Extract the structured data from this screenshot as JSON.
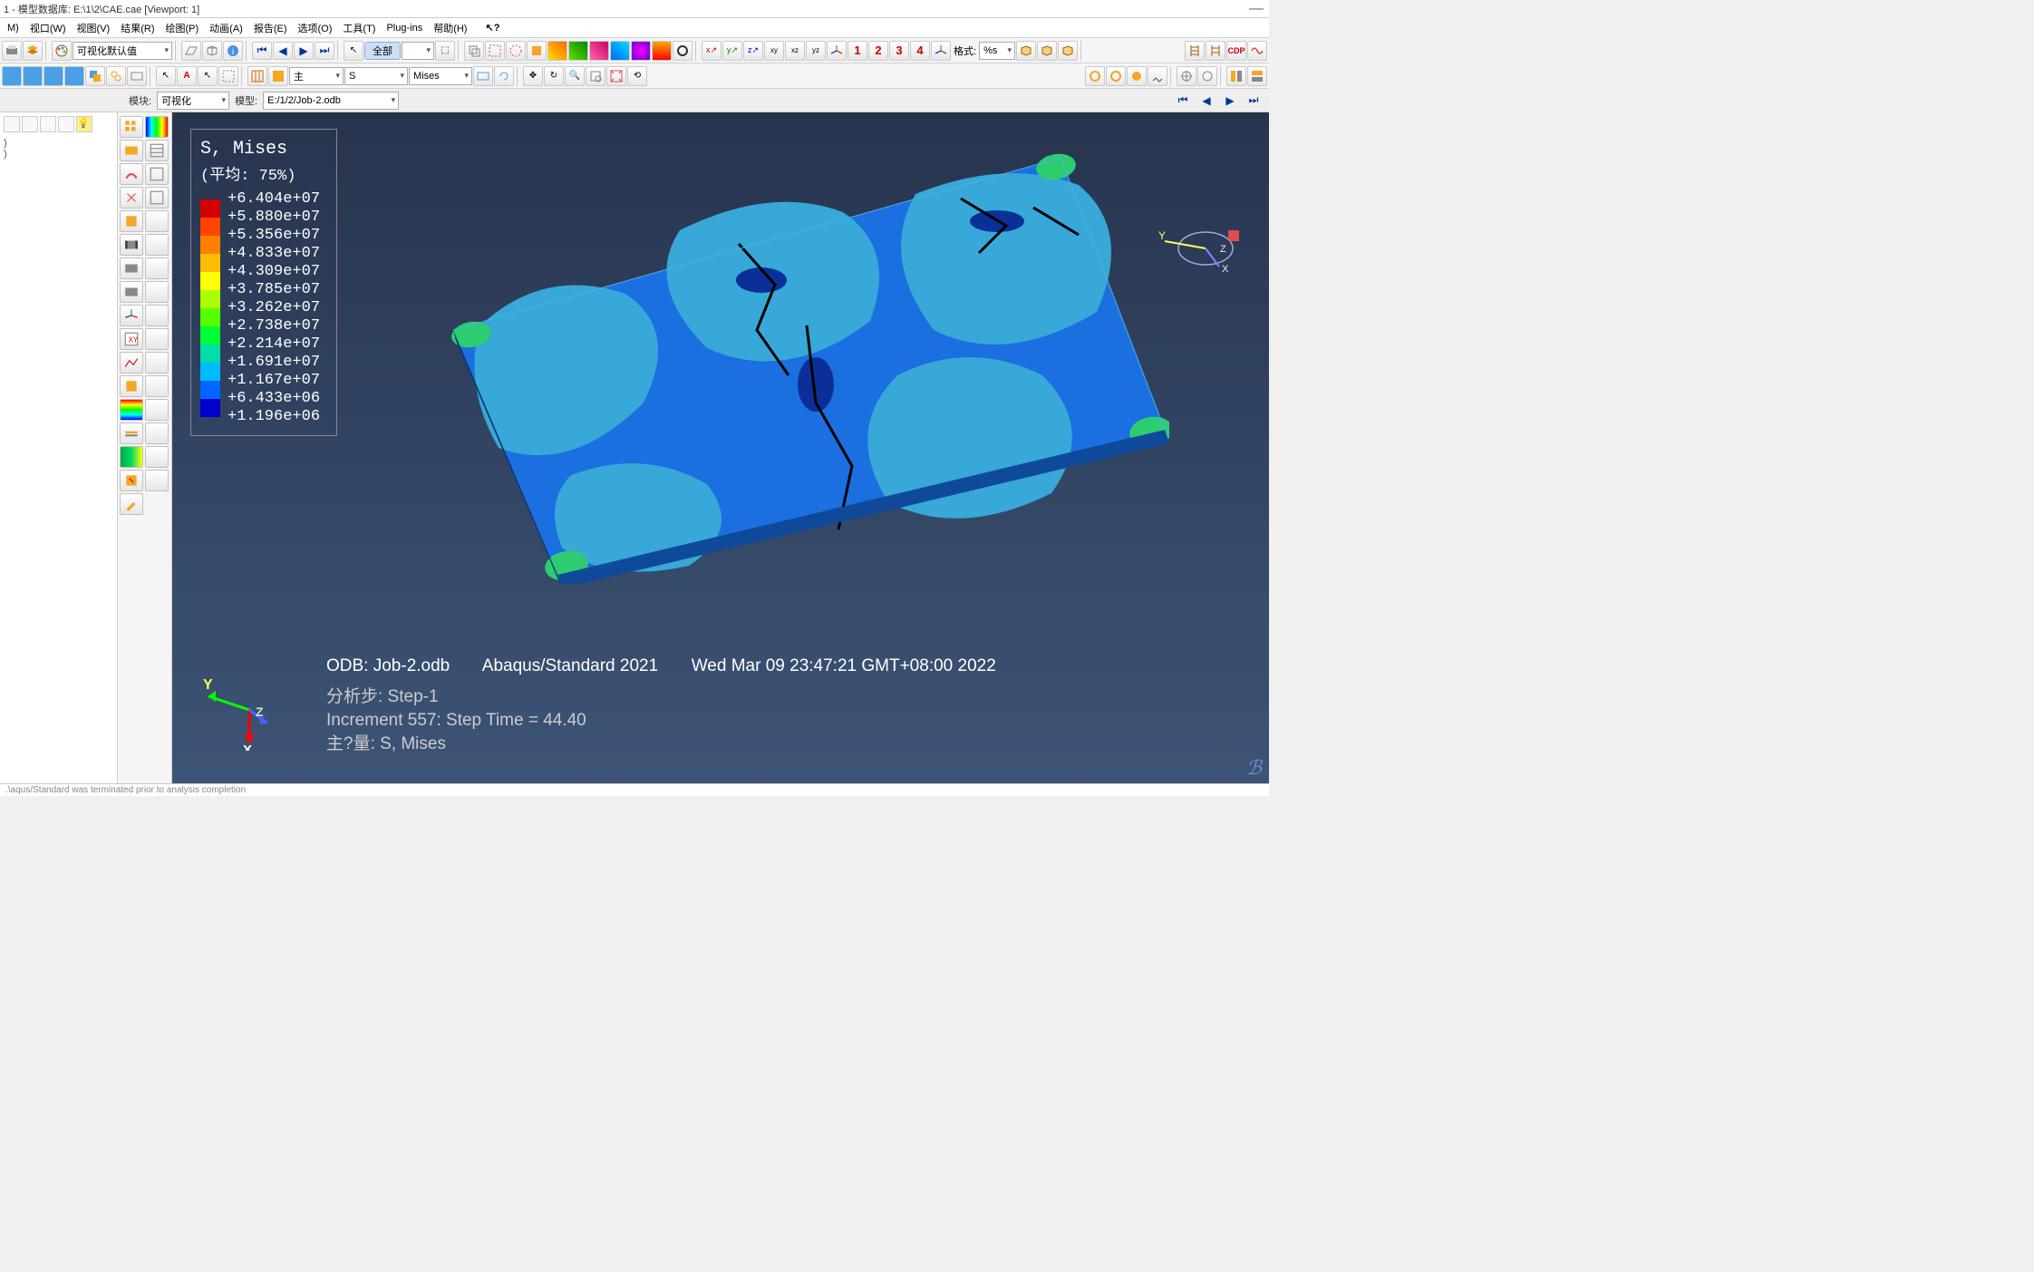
{
  "title": "1 - 模型数据库: E:\\1\\2\\CAE.cae [Viewport: 1]",
  "menu": [
    "M)",
    "视口(W)",
    "视图(V)",
    "结果(R)",
    "绘图(P)",
    "动画(A)",
    "报告(E)",
    "选项(O)",
    "工具(T)",
    "Plug-ins",
    "帮助(H)"
  ],
  "toolbar1": {
    "vis_default": "可视化默认值",
    "select_all": "全部",
    "format": "格式:",
    "format_val": "%s",
    "num1": "1",
    "num2": "2",
    "num3": "3",
    "num4": "4"
  },
  "toolbar2": {
    "primary": "主",
    "field": "S",
    "component": "Mises"
  },
  "context": {
    "module_label": "模块:",
    "module_value": "可视化",
    "model_label": "模型:",
    "model_value": "E:/1/2/Job-2.odb"
  },
  "legend": {
    "title": "S, Mises",
    "avg": "(平均: 75%)",
    "colors": [
      "#d40000",
      "#ff4400",
      "#ff8000",
      "#ffbb00",
      "#ffff00",
      "#aaff00",
      "#55ff00",
      "#00ff33",
      "#00ddaa",
      "#00bbff",
      "#0066ff",
      "#0000cc"
    ],
    "values": [
      "+6.404e+07",
      "+5.880e+07",
      "+5.356e+07",
      "+4.833e+07",
      "+4.309e+07",
      "+3.785e+07",
      "+3.262e+07",
      "+2.738e+07",
      "+2.214e+07",
      "+1.691e+07",
      "+1.167e+07",
      "+6.433e+06",
      "+1.196e+06"
    ]
  },
  "status": {
    "odb": "ODB: Job-2.odb",
    "solver": "Abaqus/Standard 2021",
    "date": "Wed Mar 09 23:47:21 GMT+08:00 2022",
    "step_label": "分析步: Step-1",
    "increment_full": "Increment    557: Step Time =    44.40",
    "primary": "主?量: S, Mises"
  },
  "bottom": ".\\aqus/Standard was terminated prior to analysis completion",
  "chart_data": {
    "type": "contour-legend",
    "field": "S, Mises",
    "average_threshold_pct": 75,
    "levels": [
      {
        "value": 64040000.0,
        "color": "#d40000"
      },
      {
        "value": 58800000.0,
        "color": "#ff4400"
      },
      {
        "value": 53560000.0,
        "color": "#ff8000"
      },
      {
        "value": 48330000.0,
        "color": "#ffbb00"
      },
      {
        "value": 43090000.0,
        "color": "#ffff00"
      },
      {
        "value": 37850000.0,
        "color": "#aaff00"
      },
      {
        "value": 32620000.0,
        "color": "#55ff00"
      },
      {
        "value": 27380000.0,
        "color": "#00ff33"
      },
      {
        "value": 22140000.0,
        "color": "#00ddaa"
      },
      {
        "value": 16910000.0,
        "color": "#00bbff"
      },
      {
        "value": 11670000.0,
        "color": "#0066ff"
      },
      {
        "value": 6433000.0,
        "color": "#0000cc"
      },
      {
        "value": 1196000.0,
        "color": "#0000cc"
      }
    ],
    "odb": "Job-2.odb",
    "solver": "Abaqus/Standard 2021",
    "timestamp": "Wed Mar 09 23:47:21 GMT+08:00 2022",
    "step": "Step-1",
    "increment": 557,
    "step_time": 44.4
  }
}
